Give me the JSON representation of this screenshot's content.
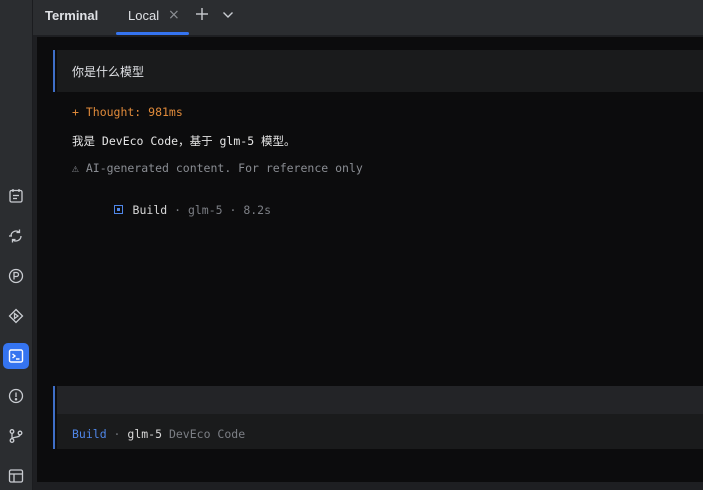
{
  "tabbar": {
    "tool_title": "Terminal",
    "tab_label": "Local",
    "close_glyph": "×",
    "icons": [
      "close-icon",
      "plus-icon",
      "chevron-down-icon"
    ]
  },
  "sidebar": {
    "icons": [
      "todo-icon",
      "sync-icon",
      "p-icon",
      "run-icon",
      "terminal-icon",
      "problems-icon",
      "git-icon",
      "layout-icon"
    ],
    "active": "terminal-icon"
  },
  "conversation": {
    "prompt": "你是什么模型",
    "thought": "+ Thought: 981ms",
    "answer": "我是 DevEco Code，基于 glm-5 模型。",
    "warning": "⚠ AI-generated content. For reference only",
    "build_label": "Build",
    "build_meta": " · glm-5 · 8.2s"
  },
  "input": {
    "mode": "Build",
    "sep": " · ",
    "model": "glm-5",
    "app": " DevEco Code"
  },
  "colors": {
    "accent": "#3574f0",
    "thought": "#e08a3a",
    "background": "#0c0c0d"
  }
}
